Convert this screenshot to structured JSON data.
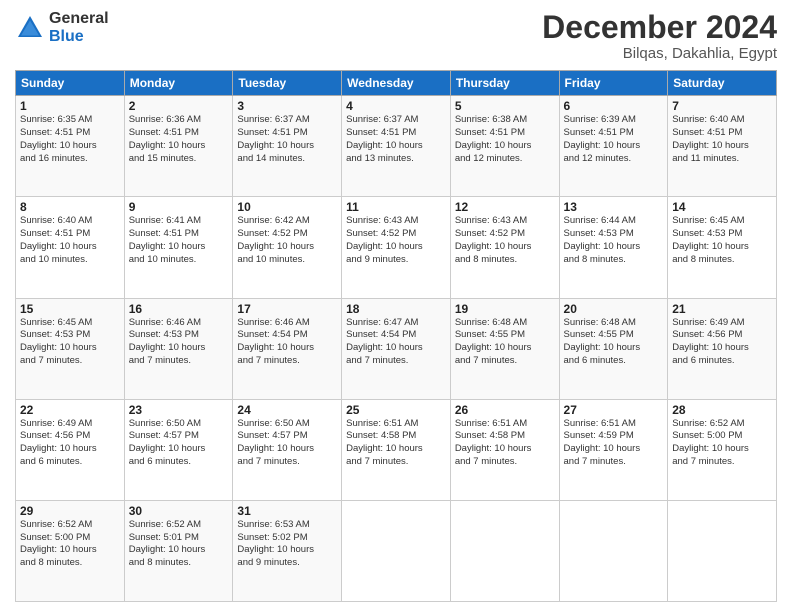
{
  "logo": {
    "general": "General",
    "blue": "Blue"
  },
  "header": {
    "month": "December 2024",
    "location": "Bilqas, Dakahlia, Egypt"
  },
  "days_of_week": [
    "Sunday",
    "Monday",
    "Tuesday",
    "Wednesday",
    "Thursday",
    "Friday",
    "Saturday"
  ],
  "weeks": [
    [
      {
        "day": "1",
        "info": "Sunrise: 6:35 AM\nSunset: 4:51 PM\nDaylight: 10 hours\nand 16 minutes."
      },
      {
        "day": "2",
        "info": "Sunrise: 6:36 AM\nSunset: 4:51 PM\nDaylight: 10 hours\nand 15 minutes."
      },
      {
        "day": "3",
        "info": "Sunrise: 6:37 AM\nSunset: 4:51 PM\nDaylight: 10 hours\nand 14 minutes."
      },
      {
        "day": "4",
        "info": "Sunrise: 6:37 AM\nSunset: 4:51 PM\nDaylight: 10 hours\nand 13 minutes."
      },
      {
        "day": "5",
        "info": "Sunrise: 6:38 AM\nSunset: 4:51 PM\nDaylight: 10 hours\nand 12 minutes."
      },
      {
        "day": "6",
        "info": "Sunrise: 6:39 AM\nSunset: 4:51 PM\nDaylight: 10 hours\nand 12 minutes."
      },
      {
        "day": "7",
        "info": "Sunrise: 6:40 AM\nSunset: 4:51 PM\nDaylight: 10 hours\nand 11 minutes."
      }
    ],
    [
      {
        "day": "8",
        "info": "Sunrise: 6:40 AM\nSunset: 4:51 PM\nDaylight: 10 hours\nand 10 minutes."
      },
      {
        "day": "9",
        "info": "Sunrise: 6:41 AM\nSunset: 4:51 PM\nDaylight: 10 hours\nand 10 minutes."
      },
      {
        "day": "10",
        "info": "Sunrise: 6:42 AM\nSunset: 4:52 PM\nDaylight: 10 hours\nand 10 minutes."
      },
      {
        "day": "11",
        "info": "Sunrise: 6:43 AM\nSunset: 4:52 PM\nDaylight: 10 hours\nand 9 minutes."
      },
      {
        "day": "12",
        "info": "Sunrise: 6:43 AM\nSunset: 4:52 PM\nDaylight: 10 hours\nand 8 minutes."
      },
      {
        "day": "13",
        "info": "Sunrise: 6:44 AM\nSunset: 4:53 PM\nDaylight: 10 hours\nand 8 minutes."
      },
      {
        "day": "14",
        "info": "Sunrise: 6:45 AM\nSunset: 4:53 PM\nDaylight: 10 hours\nand 8 minutes."
      }
    ],
    [
      {
        "day": "15",
        "info": "Sunrise: 6:45 AM\nSunset: 4:53 PM\nDaylight: 10 hours\nand 7 minutes."
      },
      {
        "day": "16",
        "info": "Sunrise: 6:46 AM\nSunset: 4:53 PM\nDaylight: 10 hours\nand 7 minutes."
      },
      {
        "day": "17",
        "info": "Sunrise: 6:46 AM\nSunset: 4:54 PM\nDaylight: 10 hours\nand 7 minutes."
      },
      {
        "day": "18",
        "info": "Sunrise: 6:47 AM\nSunset: 4:54 PM\nDaylight: 10 hours\nand 7 minutes."
      },
      {
        "day": "19",
        "info": "Sunrise: 6:48 AM\nSunset: 4:55 PM\nDaylight: 10 hours\nand 7 minutes."
      },
      {
        "day": "20",
        "info": "Sunrise: 6:48 AM\nSunset: 4:55 PM\nDaylight: 10 hours\nand 6 minutes."
      },
      {
        "day": "21",
        "info": "Sunrise: 6:49 AM\nSunset: 4:56 PM\nDaylight: 10 hours\nand 6 minutes."
      }
    ],
    [
      {
        "day": "22",
        "info": "Sunrise: 6:49 AM\nSunset: 4:56 PM\nDaylight: 10 hours\nand 6 minutes."
      },
      {
        "day": "23",
        "info": "Sunrise: 6:50 AM\nSunset: 4:57 PM\nDaylight: 10 hours\nand 6 minutes."
      },
      {
        "day": "24",
        "info": "Sunrise: 6:50 AM\nSunset: 4:57 PM\nDaylight: 10 hours\nand 7 minutes."
      },
      {
        "day": "25",
        "info": "Sunrise: 6:51 AM\nSunset: 4:58 PM\nDaylight: 10 hours\nand 7 minutes."
      },
      {
        "day": "26",
        "info": "Sunrise: 6:51 AM\nSunset: 4:58 PM\nDaylight: 10 hours\nand 7 minutes."
      },
      {
        "day": "27",
        "info": "Sunrise: 6:51 AM\nSunset: 4:59 PM\nDaylight: 10 hours\nand 7 minutes."
      },
      {
        "day": "28",
        "info": "Sunrise: 6:52 AM\nSunset: 5:00 PM\nDaylight: 10 hours\nand 7 minutes."
      }
    ],
    [
      {
        "day": "29",
        "info": "Sunrise: 6:52 AM\nSunset: 5:00 PM\nDaylight: 10 hours\nand 8 minutes."
      },
      {
        "day": "30",
        "info": "Sunrise: 6:52 AM\nSunset: 5:01 PM\nDaylight: 10 hours\nand 8 minutes."
      },
      {
        "day": "31",
        "info": "Sunrise: 6:53 AM\nSunset: 5:02 PM\nDaylight: 10 hours\nand 9 minutes."
      },
      {
        "day": "",
        "info": ""
      },
      {
        "day": "",
        "info": ""
      },
      {
        "day": "",
        "info": ""
      },
      {
        "day": "",
        "info": ""
      }
    ]
  ]
}
